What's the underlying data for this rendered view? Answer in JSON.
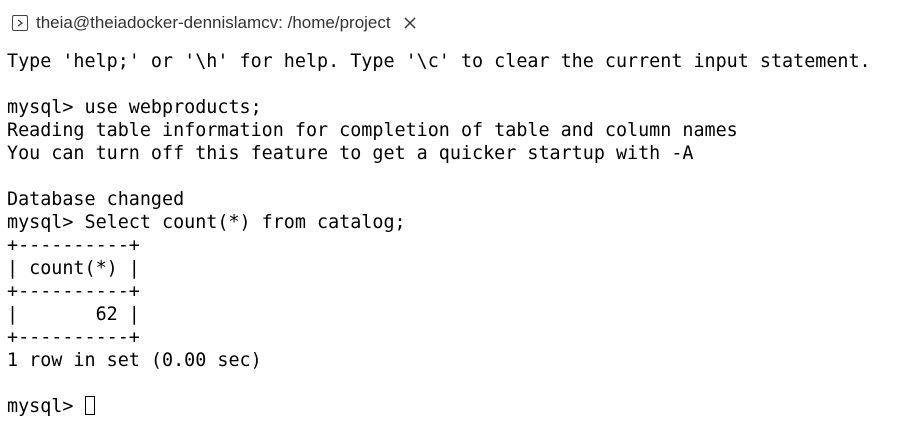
{
  "tab": {
    "title": "theia@theiadocker-dennislamcv: /home/project",
    "icon": "terminal-icon",
    "close_icon": "close-icon"
  },
  "terminal": {
    "lines": [
      "Type 'help;' or '\\h' for help. Type '\\c' to clear the current input statement.",
      "",
      "mysql> use webproducts;",
      "Reading table information for completion of table and column names",
      "You can turn off this feature to get a quicker startup with -A",
      "",
      "Database changed",
      "mysql> Select count(*) from catalog;",
      "+----------+",
      "| count(*) |",
      "+----------+",
      "|       62 |",
      "+----------+",
      "1 row in set (0.00 sec)",
      ""
    ],
    "prompt": "mysql> "
  }
}
